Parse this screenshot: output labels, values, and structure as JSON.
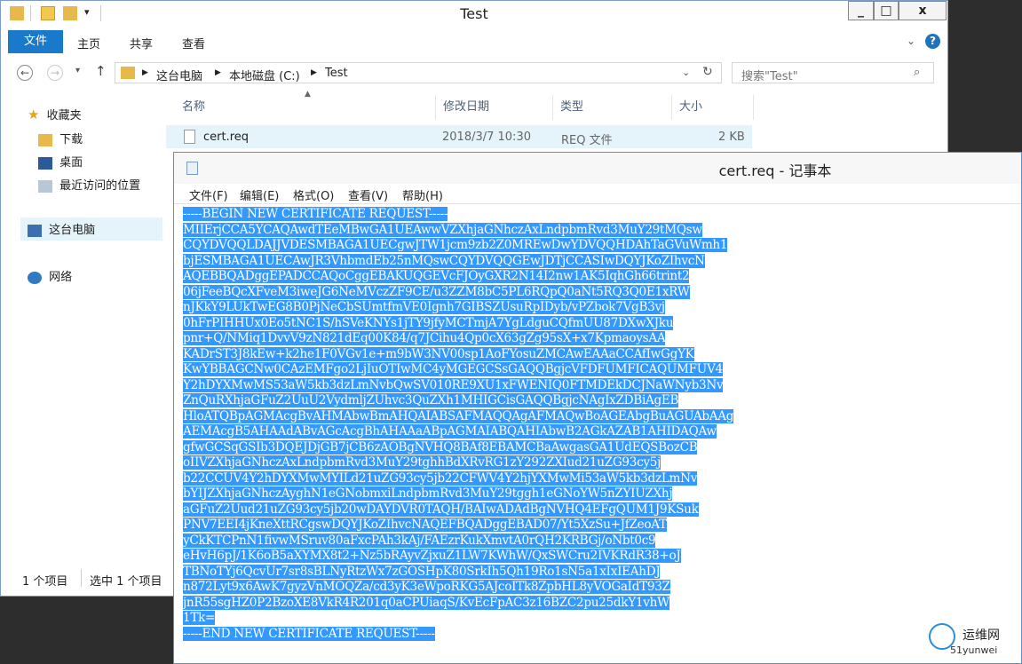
{
  "explorer": {
    "title": "Test",
    "tabs": [
      "文件",
      "主页",
      "共享",
      "查看"
    ],
    "address": {
      "crumbs": [
        "这台电脑",
        "本地磁盘 (C:)",
        "Test"
      ]
    },
    "search_placeholder": "搜索\"Test\"",
    "columns": [
      "名称",
      "修改日期",
      "类型",
      "大小"
    ],
    "files": [
      {
        "name": "cert.req",
        "modified": "2018/3/7 10:30",
        "type": "REQ 文件",
        "size": "2 KB"
      }
    ],
    "nav": {
      "favorites": "收藏夹",
      "favorites_items": [
        "下载",
        "桌面",
        "最近访问的位置"
      ],
      "this_pc": "这台电脑",
      "network": "网络"
    },
    "status": {
      "count": "1 个项目",
      "selected": "选中 1 个项目"
    }
  },
  "notepad": {
    "title": "cert.req - 记事本",
    "menu": [
      "文件(F)",
      "编辑(E)",
      "格式(O)",
      "查看(V)",
      "帮助(H)"
    ],
    "lines": [
      "-----BEGIN NEW CERTIFICATE REQUEST-----",
      "MIIErjCCA5YCAQAwdTEeMBwGA1UEAwwVZXhjaGNhczAxLndpbmRvd3MuY29tMQsw",
      "CQYDVQQLDAJJVDESMBAGA1UECgwJTW1jcm9zb2Z0MREwDwYDVQQHDAhTaGVuWmh1",
      "bjESMBAGA1UECAwJR3VhbmdEb25nMQswCQYDVQQGEwJDTjCCASIwDQYJKoZIhvcN",
      "AQEBBQADggEPADCCAQoCggEBAKUQGEVcFJOyGXR2N14I2nw1AK5IqhGh66trint2",
      "06jFeeBQcXFveM3iweJG6NeMVczZF9CE/u3ZZM8bC5PL6RQpQ0aNt5RQ3Q0E1xRW",
      "nJKkY9LUkTwEG8B0PjNeCbSUmtfmVE0Ignh7GIBSZUsuRpIDyb/vPZbok7VgB3vj",
      "0hFrPIHHUx0Eo5tNC1S/hSVeKNYs1jTY9jfyMCTmjA7YgLdguCQfmUU87DXwXJku",
      "pnr+Q/NMiq1DvvV9zN821dEq00K84/q7JCihu4Qp0cX63gZg95sX+x7KpmaoysAA",
      "KADrST3J8kEw+k2he1F0VGv1e+m9bW3NV00sp1AoFYosuZMCAwEAAaCCAfIwGgYK",
      "KwYBBAGCNw0CAzEMFgo2LjIuOTIwMC4yMGEGCSsGAQQBgjcVFDFUMFICAQUMFUV4",
      "Y2hDYXMwMS53aW5kb3dzLmNvbQwSV010RE9XU1xFWENIQ0FTMDEkDCJNaWNyb3Nv",
      "ZnQuRXhjaGFuZ2UuU2VydmljZUhvc3QuZXh1MHIGCisGAQQBgjcNAgIxZDBiAgEB",
      "HloATQBpAGMAcgBvAHMAbwBmAHQAIABSAFMAQQAgAFMAQwBoAGEAbgBuAGUAbAAg",
      "AEMAcgB5AHAAdABvAGcAcgBhAHAAaABpAGMAIABQAHIAbwB2AGkAZAB1AHIDAQAw",
      "gfwGCSqGSIb3DQEJDjGB7jCB6zAOBgNVHQ8BAf8EBAMCBaAwgasGA1UdEQSBozCB",
      "oIIVZXhjaGNhczAxLndpbmRvd3MuY29tghhBdXRvRG1zY292ZXIud21uZG93cy5j",
      "b22CCUV4Y2hDYXMwMYILd21uZG93cy5jb22CFWV4Y2hjYXMwMi53aW5kb3dzLmNv",
      "bYIJZXhjaGNhczAyghN1eGNobmxiLndpbmRvd3MuY29tggh1eGNoYW5nZYIUZXhj",
      "aGFuZ2Uud21uZG93cy5jb20wDAYDVR0TAQH/BAIwADAdBgNVHQ4EFgQUM1J9KSuk",
      "PNV7EEI4jKneXttRCgswDQYJKoZIhvcNAQEFBQADggEBAD07/Yt5XzSu+JfZeoAT",
      "yCkKTCPnN1fivwMSruv80aFxcPAh3kAj/FAEzrKukXmvtA0rQH2KRBGj/oNbt0c9",
      "eHvH6pJ/1K6oB5aXYMX8t2+Nz5bRAyvZjxuZ1LW7KWhW/QxSWCru2IVKRdR38+oJ",
      "TBNoTYj6QcvUr7sr8sBLNyRtzWx7zGOSHpK80SrkIh5Qh19Ro1sN5a1xIxIEAhDJ",
      "n872Lyt9x6AwK7gyzVnMOQZa/cd3yK3eWpoRKG5AJcoITk8ZpbHL8yVOGaIdT93Z",
      "jnR55sgHZ0P2BzoXE8VkR4R201q0aCPUiaqS/KvEcFpAC3z16BZC2pu25dkY1vhW",
      "1Tk=",
      "-----END NEW CERTIFICATE REQUEST-----"
    ]
  },
  "watermark": {
    "text": "运维网",
    "subtext": "51yunwei"
  }
}
